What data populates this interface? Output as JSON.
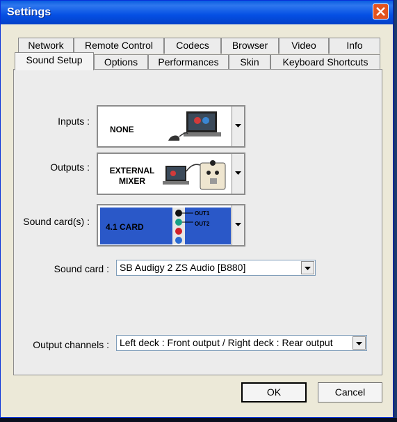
{
  "window": {
    "title": "Settings"
  },
  "tabs_top": [
    "Network",
    "Remote Control",
    "Codecs",
    "Browser",
    "Video",
    "Info"
  ],
  "tabs_bottom": [
    "Sound Setup",
    "Options",
    "Performances",
    "Skin",
    "Keyboard Shortcuts"
  ],
  "active_tab": "Sound Setup",
  "fields": {
    "inputs": {
      "label": "Inputs :",
      "value": "NONE"
    },
    "outputs": {
      "label": "Outputs :",
      "value_line1": "EXTERNAL",
      "value_line2": "MIXER"
    },
    "soundcards": {
      "label": "Sound card(s) :",
      "value": "4.1 CARD",
      "out1": "OUT1",
      "out2": "OUT2"
    },
    "soundcard": {
      "label": "Sound card :",
      "value": "SB Audigy 2 ZS Audio [B880]"
    },
    "output_channels": {
      "label": "Output channels :",
      "value": "Left deck : Front output / Right deck : Rear output"
    }
  },
  "buttons": {
    "ok": "OK",
    "cancel": "Cancel"
  },
  "colors": {
    "titlebar": "#0550e4",
    "card_panel": "#2a58c8",
    "close": "#e4531e"
  }
}
